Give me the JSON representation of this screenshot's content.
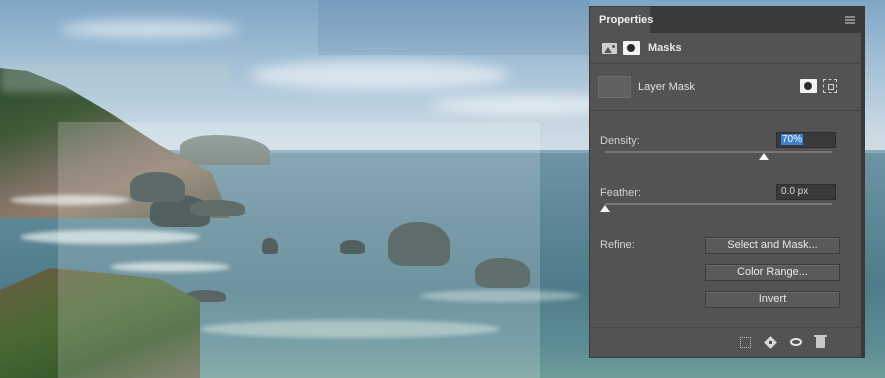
{
  "panel": {
    "tab_title": "Properties",
    "section_label": "Masks",
    "layer_mask_label": "Layer Mask",
    "density": {
      "label": "Density:",
      "value": "70%",
      "level_percent": 70
    },
    "feather": {
      "label": "Feather:",
      "value": "0.0 px",
      "level_percent": 0
    },
    "refine": {
      "label": "Refine:",
      "buttons": [
        "Select and Mask...",
        "Color Range...",
        "Invert"
      ]
    },
    "bottom_icons": [
      "load-selection-icon",
      "apply-mask-icon",
      "toggle-visibility-icon",
      "delete-mask-icon"
    ]
  }
}
